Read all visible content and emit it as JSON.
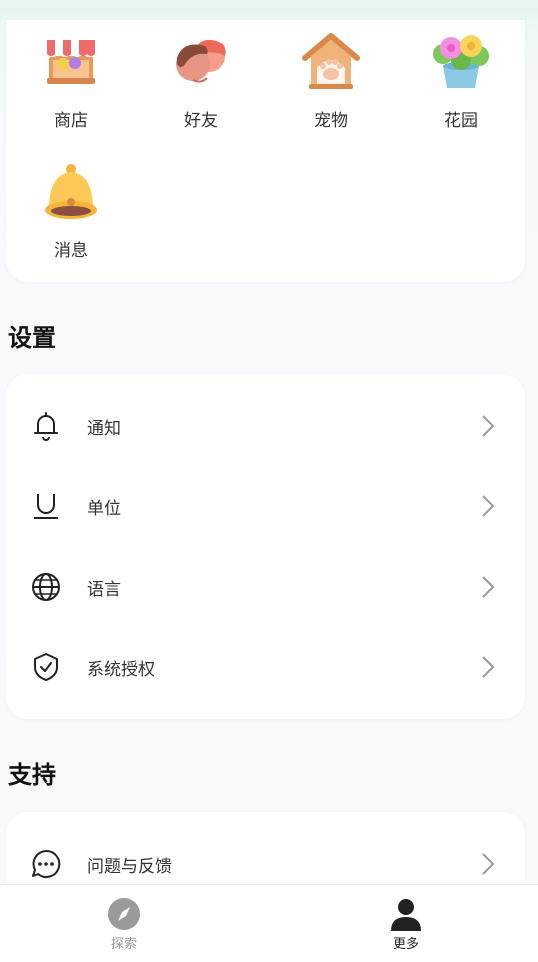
{
  "grid": [
    {
      "label": "商店",
      "icon": "shop-icon"
    },
    {
      "label": "好友",
      "icon": "friends-icon"
    },
    {
      "label": "宠物",
      "icon": "pet-house-icon"
    },
    {
      "label": "花园",
      "icon": "garden-flowers-icon"
    },
    {
      "label": "消息",
      "icon": "bell-message-icon"
    }
  ],
  "settings": {
    "title": "设置",
    "items": [
      {
        "label": "通知",
        "icon": "bell-icon"
      },
      {
        "label": "单位",
        "icon": "underline-unit-icon"
      },
      {
        "label": "语言",
        "icon": "globe-icon"
      },
      {
        "label": "系统授权",
        "icon": "shield-check-icon"
      }
    ]
  },
  "support": {
    "title": "支持",
    "items": [
      {
        "label": "问题与反馈",
        "icon": "chat-dots-icon"
      }
    ]
  },
  "tabs": [
    {
      "label": "探索",
      "icon": "compass-icon",
      "active": false
    },
    {
      "label": "更多",
      "icon": "person-icon",
      "active": true
    }
  ],
  "colors": {
    "accent": "#222222",
    "inactive": "#9a9a9a"
  }
}
